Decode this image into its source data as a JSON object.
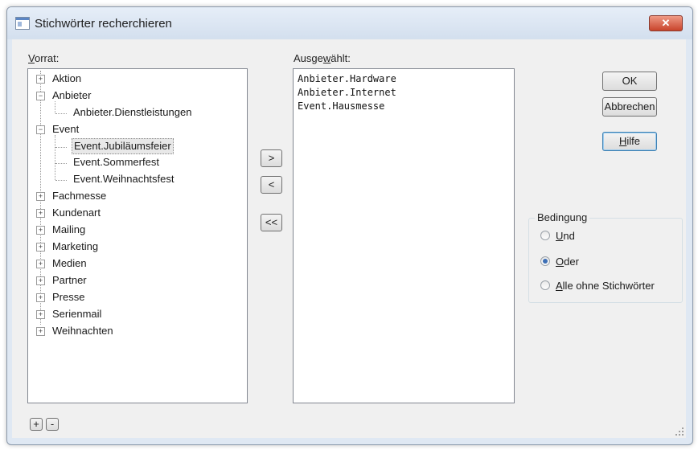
{
  "window": {
    "title": "Stichwörter recherchieren",
    "close_glyph": "✕"
  },
  "stock": {
    "label_first": "V",
    "label_rest": "orrat:",
    "items": [
      {
        "label": "Aktion",
        "expander": "+"
      },
      {
        "label": "Anbieter",
        "expander": "−"
      },
      {
        "label": "Anbieter.Dienstleistungen",
        "expander": ""
      },
      {
        "label": "Event",
        "expander": "−"
      },
      {
        "label": "Event.Jubiläumsfeier",
        "expander": ""
      },
      {
        "label": "Event.Sommerfest",
        "expander": ""
      },
      {
        "label": "Event.Weihnachtsfest",
        "expander": ""
      },
      {
        "label": "Fachmesse",
        "expander": "+"
      },
      {
        "label": "Kundenart",
        "expander": "+"
      },
      {
        "label": "Mailing",
        "expander": "+"
      },
      {
        "label": "Marketing",
        "expander": "+"
      },
      {
        "label": "Medien",
        "expander": "+"
      },
      {
        "label": "Partner",
        "expander": "+"
      },
      {
        "label": "Presse",
        "expander": "+"
      },
      {
        "label": "Serienmail",
        "expander": "+"
      },
      {
        "label": "Weihnachten",
        "expander": "+"
      }
    ],
    "selected_item": "Event.Jubiläumsfeier",
    "add_label": "+",
    "remove_label": "-"
  },
  "selected": {
    "label_a": "Ausge",
    "label_u": "w",
    "label_b": "ählt:",
    "items": [
      "Anbieter.Hardware",
      "Anbieter.Internet",
      "Event.Hausmesse"
    ]
  },
  "transfer": {
    "add": ">",
    "remove": "<",
    "remove_all": "<<"
  },
  "buttons": {
    "ok": "OK",
    "cancel": "Abbrechen",
    "help_first": "H",
    "help_rest": "ilfe"
  },
  "condition": {
    "title": "Bedingung",
    "options": [
      {
        "u": "U",
        "rest": "nd",
        "checked": false
      },
      {
        "u": "O",
        "rest": "der",
        "checked": true
      },
      {
        "u": "A",
        "rest": "lle ohne Stichwörter",
        "checked": false
      }
    ]
  }
}
